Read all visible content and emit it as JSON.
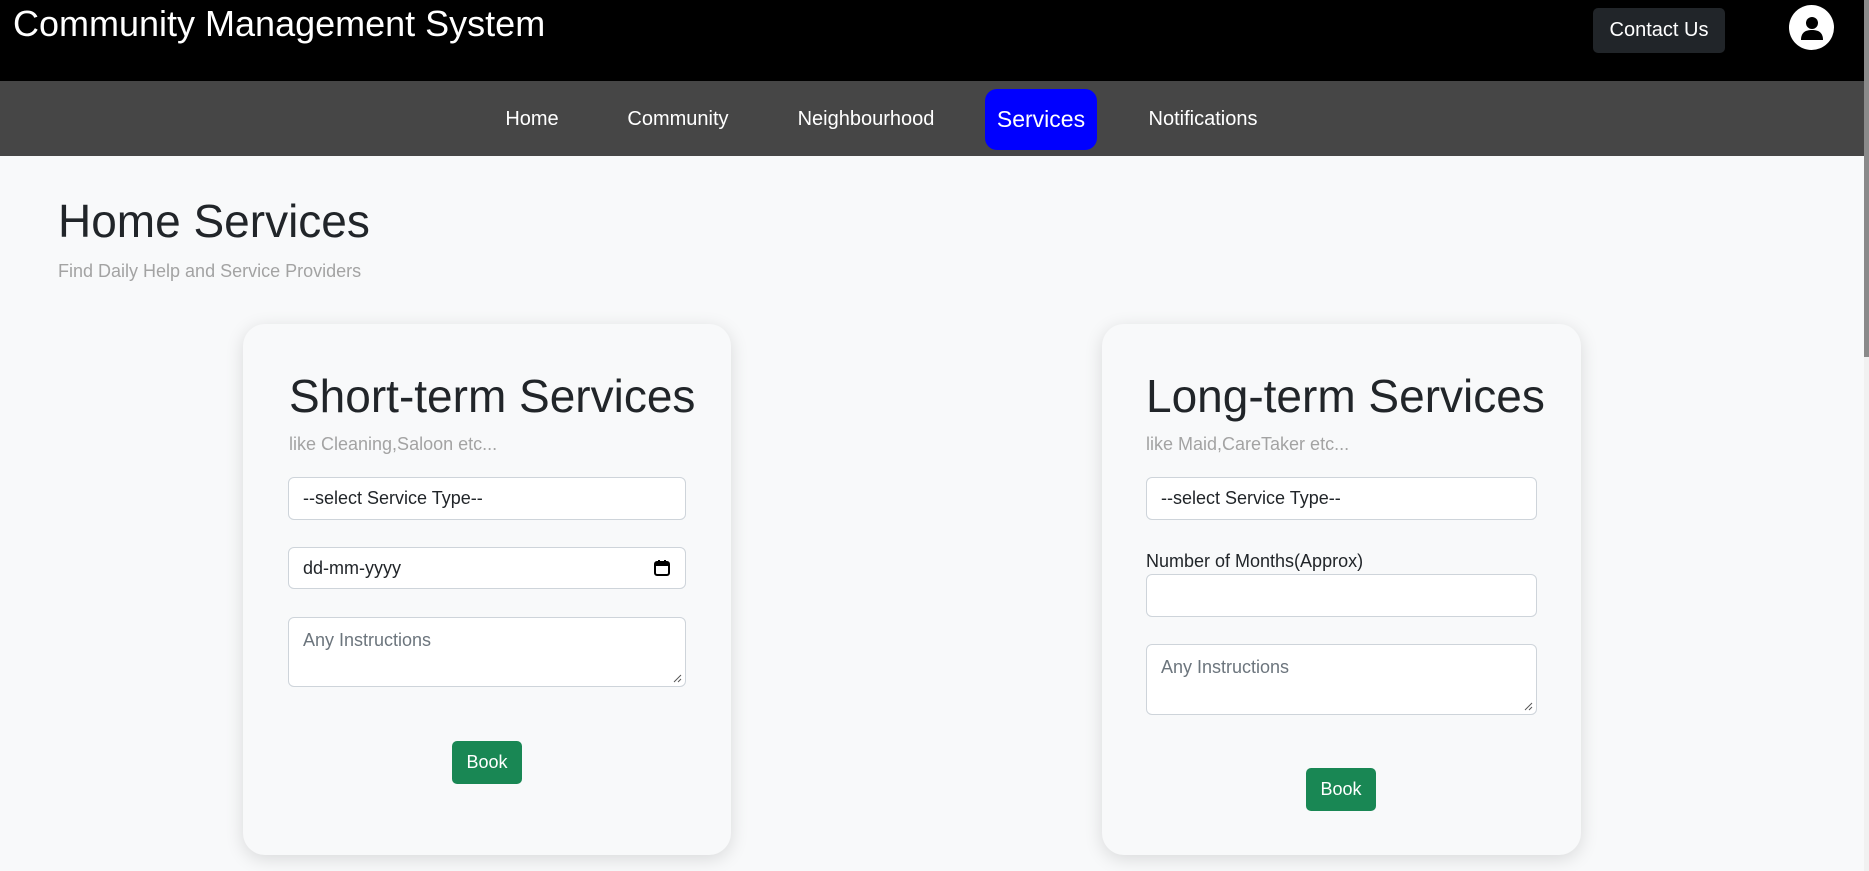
{
  "header": {
    "title": "Community Management System",
    "contact_label": "Contact Us",
    "avatar_icon": "user-circle-icon"
  },
  "nav": {
    "items": [
      {
        "label": "Home",
        "active": false
      },
      {
        "label": "Community",
        "active": false
      },
      {
        "label": "Neighbourhood",
        "active": false
      },
      {
        "label": "Services",
        "active": true
      },
      {
        "label": "Notifications",
        "active": false
      }
    ],
    "active_color": "#0000ff"
  },
  "page": {
    "title": "Home Services",
    "subtitle": "Find Daily Help and Service Providers"
  },
  "short_term": {
    "title": "Short-term Services",
    "subtitle": "like Cleaning,Saloon etc...",
    "service_select_value": "--select Service Type--",
    "date_value": "dd-mm-yyyy",
    "date_icon": "calendar-icon",
    "instructions_placeholder": "Any Instructions",
    "book_label": "Book"
  },
  "long_term": {
    "title": "Long-term Services",
    "subtitle": "like Maid,CareTaker etc...",
    "service_select_value": "--select Service Type--",
    "months_label": "Number of Months(Approx)",
    "months_value": "",
    "instructions_placeholder": "Any Instructions",
    "book_label": "Book"
  },
  "colors": {
    "header_bg": "#000000",
    "nav_bg": "#464646",
    "book_button": "#198754",
    "page_bg": "#f8f9fa"
  }
}
